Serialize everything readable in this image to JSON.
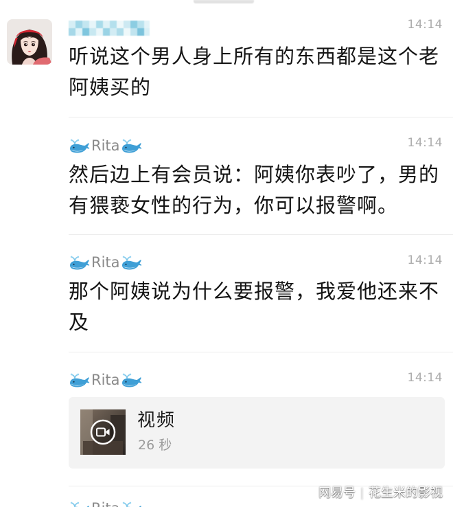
{
  "theme": {
    "text": "#141414",
    "time": "#adadad",
    "sender": "#8a8a8a",
    "card": "#f3f3f3",
    "divider": "#ececec"
  },
  "messages": [
    {
      "avatar_icon": "woman-avatar-icon",
      "time": "14:14",
      "lines": [
        "听说这个男人身上所有的东西都是这个老",
        "阿姨买的"
      ]
    },
    {
      "sender": "Rita",
      "sender_icon": "whale-icon",
      "time": "14:14",
      "lines": [
        "然后边上有会员说：阿姨你表吵了，男的",
        "有猥亵女性的行为，你可以报警啊。"
      ]
    },
    {
      "sender": "Rita",
      "sender_icon": "whale-icon",
      "time": "14:14",
      "lines": [
        "那个阿姨说为什么要报警，我爱他还来不",
        "及"
      ]
    },
    {
      "sender": "Rita",
      "sender_icon": "whale-icon",
      "time": "14:14",
      "video": {
        "title": "视频",
        "duration": "26 秒",
        "icon": "video-camera-icon"
      }
    },
    {
      "sender": "Rita",
      "sender_icon": "whale-icon"
    }
  ],
  "watermark": {
    "platform": "网易号",
    "account": "花生米的影视"
  }
}
